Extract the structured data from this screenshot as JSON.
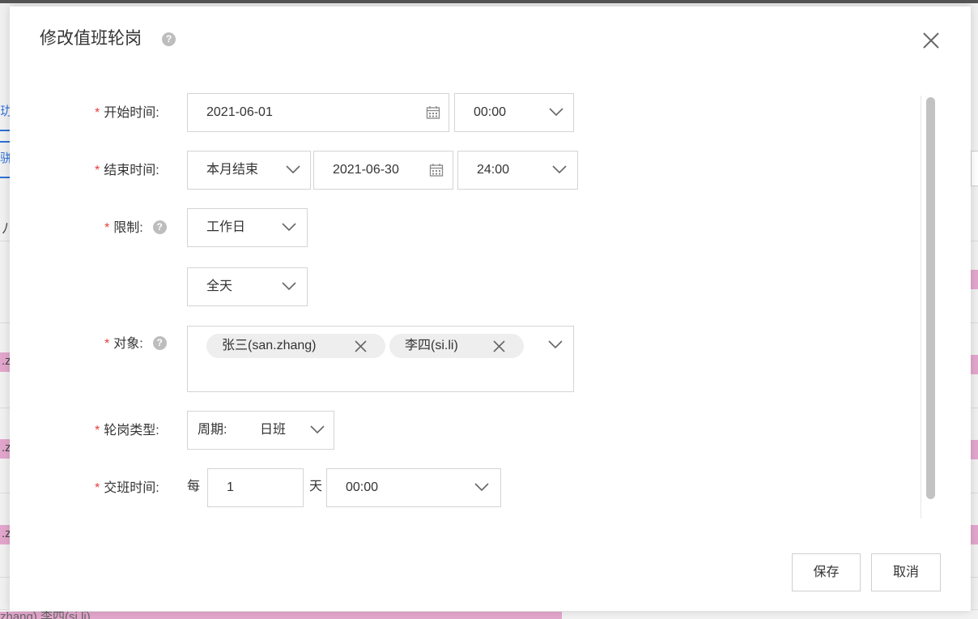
{
  "dialog": {
    "title": "修改值班轮岗",
    "close_icon": "close-icon",
    "help_icon": "question-circle-icon"
  },
  "form": {
    "required_mark": "*",
    "start_time": {
      "label": "开始时间:",
      "date": "2021-06-01",
      "time": "00:00"
    },
    "end_time": {
      "label": "结束时间:",
      "mode": "本月结束",
      "date": "2021-06-30",
      "time": "24:00"
    },
    "limit": {
      "label": "限制:",
      "day_type": "工作日",
      "period": "全天"
    },
    "target": {
      "label": "对象:",
      "tags": [
        "张三(san.zhang)",
        "李四(si.li)"
      ]
    },
    "rotation_type": {
      "label": "轮岗类型:",
      "prefix": "周期:",
      "value": "日班"
    },
    "handover_time": {
      "label": "交班时间:",
      "every": "每",
      "count": "1",
      "unit": "天",
      "time": "00:00"
    }
  },
  "footer": {
    "save_label": "保存",
    "cancel_label": "取消"
  },
  "background": {
    "tab1_fragment": "玏",
    "tab2_fragment": "骈",
    "header_fragment": "ﾉ",
    "row_fragment": ".z",
    "bottom_fragment": "zhang) 李四(si.li)"
  },
  "colors": {
    "required": "#e3413b",
    "link": "#2f6fd8",
    "schedule_bar": "#e2a6cc"
  }
}
